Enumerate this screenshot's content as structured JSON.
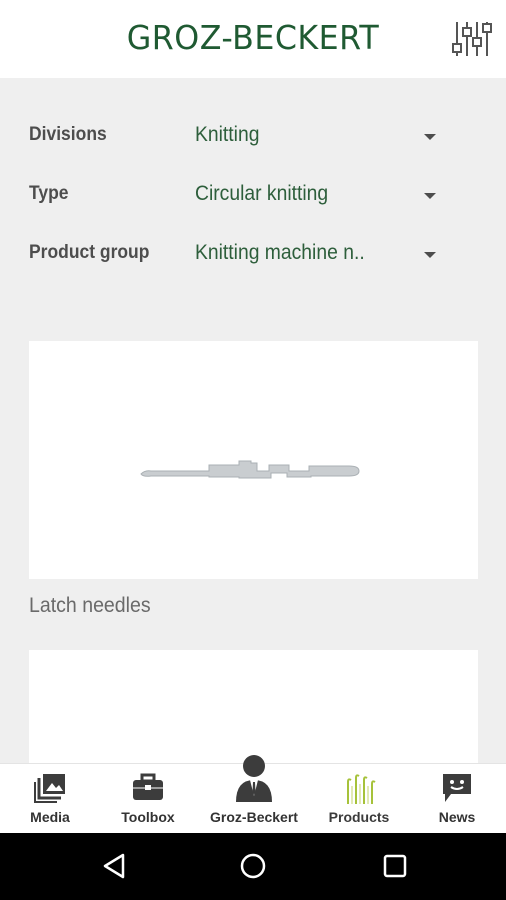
{
  "header": {
    "logo_text": "GROZ-BECKERT",
    "filter_icon": "sliders-icon"
  },
  "filters": [
    {
      "label": "Divisions",
      "value": "Knitting"
    },
    {
      "label": "Type",
      "value": "Circular knitting"
    },
    {
      "label": "Product group",
      "value": "Knitting machine n.."
    }
  ],
  "products": [
    {
      "caption": "Latch needles",
      "image": "latch-needle-image"
    },
    {
      "caption": "",
      "image": ""
    }
  ],
  "tabs": [
    {
      "label": "Media",
      "icon": "media-gallery-icon"
    },
    {
      "label": "Toolbox",
      "icon": "toolbox-icon"
    },
    {
      "label": "Groz-Beckert",
      "icon": "person-icon"
    },
    {
      "label": "Products",
      "icon": "needles-icon",
      "active": true
    },
    {
      "label": "News",
      "icon": "chat-bubble-icon"
    }
  ],
  "colors": {
    "brand_green": "#1f5a32",
    "value_green": "#2d5e3b",
    "active_tab": "#a6c23a",
    "background": "#efefef"
  },
  "system_nav": [
    "back-icon",
    "home-icon",
    "recents-icon"
  ]
}
